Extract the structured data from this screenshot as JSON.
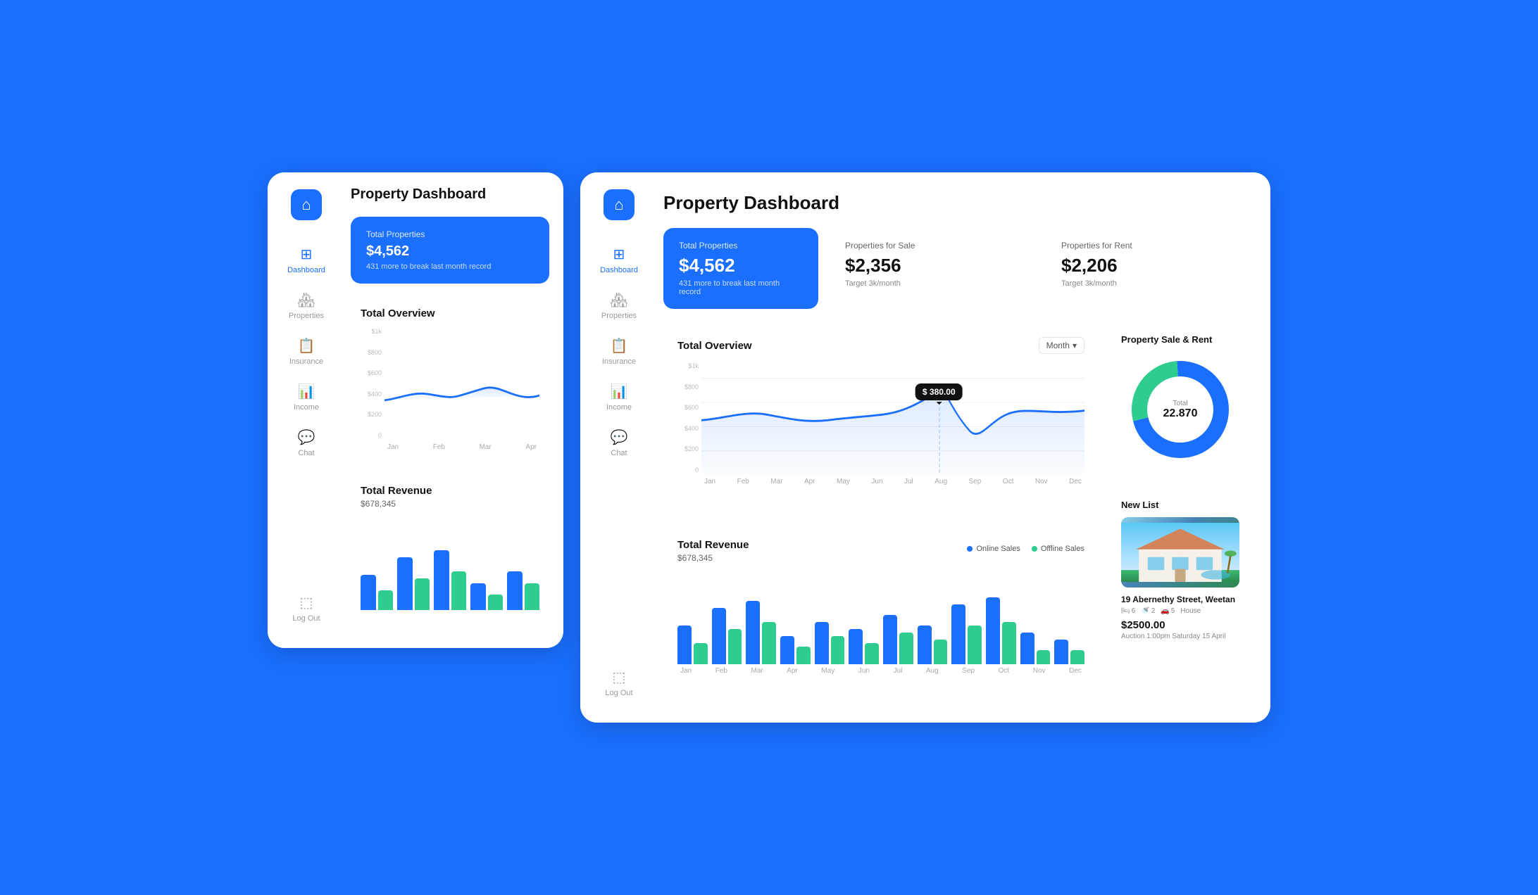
{
  "app": {
    "logo_icon": "🏠",
    "title": "Property Dashboard"
  },
  "sidebar": {
    "items": [
      {
        "id": "dashboard",
        "label": "Dashboard",
        "icon": "⊞",
        "active": true
      },
      {
        "id": "properties",
        "label": "Properties",
        "icon": "🏘"
      },
      {
        "id": "insurance",
        "label": "Insurance",
        "icon": "📋"
      },
      {
        "id": "income",
        "label": "Income",
        "icon": "📊"
      },
      {
        "id": "chat",
        "label": "Chat",
        "icon": "💬"
      }
    ],
    "logout_label": "Log Out",
    "logout_icon": "🚪"
  },
  "stats": {
    "total_properties": {
      "label": "Total Properties",
      "value": "$4,562",
      "sub": "431 more to break last month record"
    },
    "for_sale": {
      "label": "Properties for Sale",
      "value": "$2,356",
      "sub": "Target 3k/month"
    },
    "for_rent": {
      "label": "Properties for Rent",
      "value": "$2,206",
      "sub": "Target 3k/month"
    }
  },
  "overview_chart": {
    "title": "Total Overview",
    "month_selector": "Month",
    "tooltip": "$ 380.00",
    "y_labels": [
      "$1k",
      "$800",
      "$600",
      "$400",
      "$200",
      "0"
    ],
    "x_labels": [
      "Jan",
      "Feb",
      "Mar",
      "Apr",
      "May",
      "Jun",
      "Jul",
      "Aug",
      "Sep",
      "Oct",
      "Nov",
      "Dec"
    ]
  },
  "revenue_chart": {
    "title": "Total Revenue",
    "value": "$678,345",
    "legend_online": "Online Sales",
    "legend_offline": "Offline Sales",
    "x_labels": [
      "Jan",
      "Feb",
      "Mar",
      "Apr",
      "May",
      "Jun",
      "Jul",
      "Aug",
      "Sep",
      "Oct",
      "Nov",
      "Dec"
    ],
    "bars": [
      {
        "blue": 55,
        "green": 30
      },
      {
        "blue": 80,
        "green": 50
      },
      {
        "blue": 90,
        "green": 60
      },
      {
        "blue": 40,
        "green": 25
      },
      {
        "blue": 60,
        "green": 40
      },
      {
        "blue": 50,
        "green": 30
      },
      {
        "blue": 70,
        "green": 45
      },
      {
        "blue": 55,
        "green": 35
      },
      {
        "blue": 85,
        "green": 55
      },
      {
        "blue": 95,
        "green": 60
      },
      {
        "blue": 45,
        "green": 20
      },
      {
        "blue": 35,
        "green": 20
      }
    ]
  },
  "donut_chart": {
    "title": "Property Sale & Rent",
    "total_label": "Total",
    "total_value": "22.870",
    "blue_pct": 72,
    "green_pct": 28
  },
  "new_listing": {
    "title": "New List",
    "property_name": "19 Abernethy Street, Weetan",
    "beds": "6",
    "baths": "2",
    "parking": "5",
    "type": "House",
    "price": "$2500.00",
    "auction": "Auction 1:00pm Saturday 15 April"
  }
}
